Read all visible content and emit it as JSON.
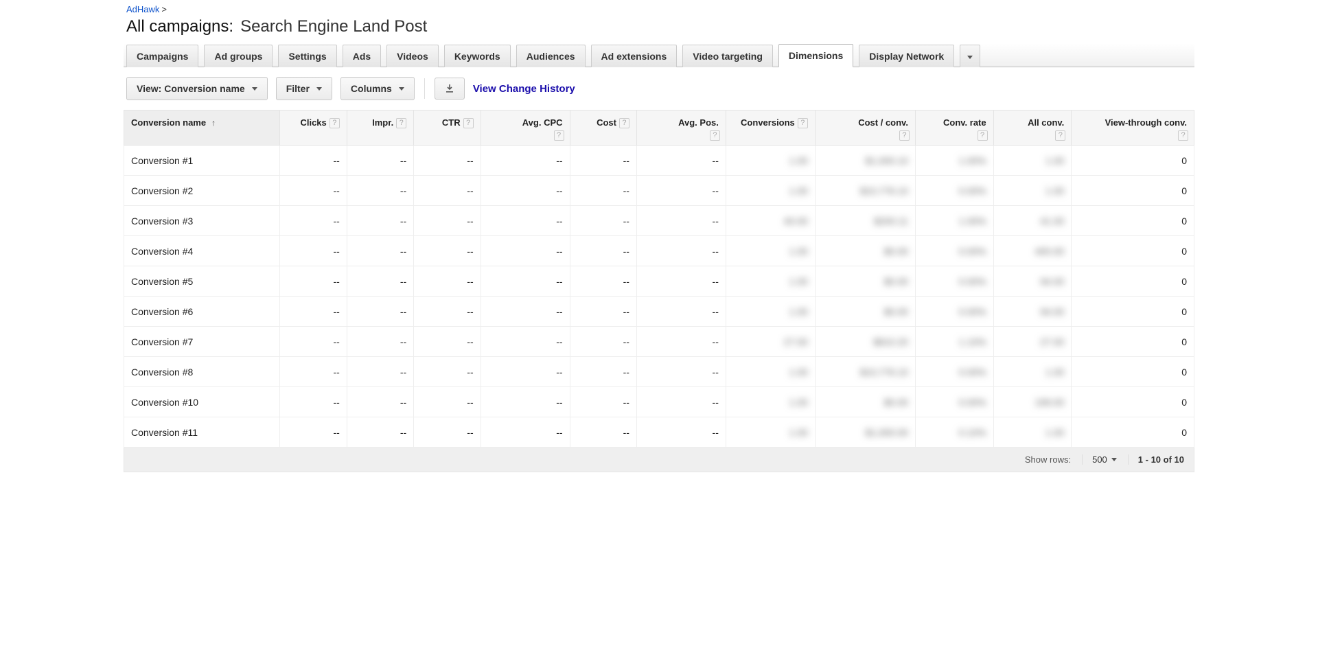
{
  "breadcrumb": {
    "link": "AdHawk",
    "sep": ">"
  },
  "title": {
    "label": "All campaigns:",
    "name": "Search Engine Land Post"
  },
  "tabs": [
    "Campaigns",
    "Ad groups",
    "Settings",
    "Ads",
    "Videos",
    "Keywords",
    "Audiences",
    "Ad extensions",
    "Video targeting",
    "Dimensions",
    "Display Network"
  ],
  "active_tab_index": 9,
  "toolbar": {
    "view_label": "View: Conversion name",
    "filter_label": "Filter",
    "columns_label": "Columns",
    "change_history_label": "View Change History"
  },
  "columns": [
    {
      "label": "Conversion name",
      "help": false,
      "help_below": false,
      "first": true,
      "sort": "asc",
      "w": "14%"
    },
    {
      "label": "Clicks",
      "help": true,
      "help_below": false,
      "w": "6%"
    },
    {
      "label": "Impr.",
      "help": true,
      "help_below": false,
      "w": "6%"
    },
    {
      "label": "CTR",
      "help": true,
      "help_below": false,
      "w": "6%"
    },
    {
      "label": "Avg. CPC",
      "help": false,
      "help_below": true,
      "w": "8%"
    },
    {
      "label": "Cost",
      "help": true,
      "help_below": false,
      "w": "6%"
    },
    {
      "label": "Avg. Pos.",
      "help": false,
      "help_below": true,
      "w": "8%"
    },
    {
      "label": "Conversions",
      "help": true,
      "help_below": false,
      "w": "8%"
    },
    {
      "label": "Cost / conv.",
      "help": false,
      "help_below": true,
      "w": "9%"
    },
    {
      "label": "Conv. rate",
      "help": false,
      "help_below": true,
      "w": "7%"
    },
    {
      "label": "All conv.",
      "help": false,
      "help_below": true,
      "w": "7%"
    },
    {
      "label": "View-through conv.",
      "help": false,
      "help_below": true,
      "w": "11%"
    }
  ],
  "dash": "--",
  "rows": [
    {
      "name": "Conversion #1",
      "blurs": [
        "1.00",
        "$1,000.10",
        "1.00%",
        "1.00"
      ],
      "vtc": "0"
    },
    {
      "name": "Conversion #2",
      "blurs": [
        "1.00",
        "$10,776.10",
        "0.00%",
        "1.00"
      ],
      "vtc": "0"
    },
    {
      "name": "Conversion #3",
      "blurs": [
        "40.00",
        "$200.11",
        "1.00%",
        "41.00"
      ],
      "vtc": "0"
    },
    {
      "name": "Conversion #4",
      "blurs": [
        "1.00",
        "$0.00",
        "0.00%",
        "400.00"
      ],
      "vtc": "0"
    },
    {
      "name": "Conversion #5",
      "blurs": [
        "1.00",
        "$0.00",
        "0.00%",
        "94.00"
      ],
      "vtc": "0"
    },
    {
      "name": "Conversion #6",
      "blurs": [
        "1.00",
        "$0.00",
        "0.00%",
        "94.00"
      ],
      "vtc": "0"
    },
    {
      "name": "Conversion #7",
      "blurs": [
        "27.00",
        "$810.20",
        "1.10%",
        "27.00"
      ],
      "vtc": "0"
    },
    {
      "name": "Conversion #8",
      "blurs": [
        "1.00",
        "$10,776.10",
        "0.00%",
        "1.00"
      ],
      "vtc": "0"
    },
    {
      "name": "Conversion #10",
      "blurs": [
        "1.00",
        "$0.00",
        "0.00%",
        "199.00"
      ],
      "vtc": "0"
    },
    {
      "name": "Conversion #11",
      "blurs": [
        "1.00",
        "$1,000.00",
        "0.10%",
        "1.00"
      ],
      "vtc": "0"
    }
  ],
  "footer": {
    "show_rows_label": "Show rows:",
    "rows_value": "500",
    "range": "1 - 10 of 10"
  }
}
